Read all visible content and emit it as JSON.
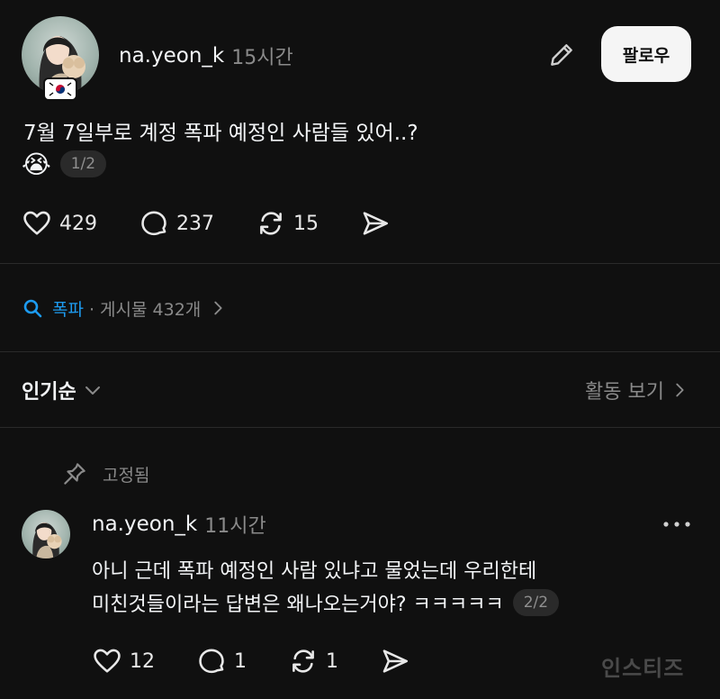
{
  "post": {
    "username": "na.yeon_k",
    "time": "15시간",
    "follow_label": "팔로우",
    "text_line1": "7월 7일부로 계정 폭파 예정인 사람들 있어..?",
    "emoji": "😭",
    "page_indicator": "1/2",
    "likes": "429",
    "comments": "237",
    "reposts": "15",
    "flag_icon": "south-korea-flag-icon"
  },
  "topic": {
    "tag": "폭파",
    "meta": "· 게시물 432개"
  },
  "sort": {
    "label": "인기순",
    "activity_label": "활동 보기"
  },
  "reply": {
    "pinned_label": "고정됨",
    "username": "na.yeon_k",
    "time": "11시간",
    "text_line1": "아니 근데 폭파 예정인 사람 있냐고 물었는데 우리한테",
    "text_line2": "미친것들이라는 답변은 왜나오는거야? ㅋㅋㅋㅋㅋ",
    "page_indicator": "2/2",
    "likes": "12",
    "comments": "1",
    "reposts": "1"
  },
  "watermark": "인스티즈",
  "colors": {
    "background": "#101010",
    "accent": "#1d9bf0",
    "muted": "#8a8a8a"
  }
}
